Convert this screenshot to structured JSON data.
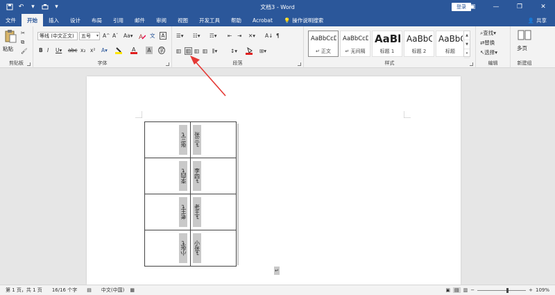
{
  "window": {
    "title": "文档3 - Word",
    "login_label": "登录",
    "share_label": "共享"
  },
  "tabs": [
    {
      "label": "文件"
    },
    {
      "label": "开始"
    },
    {
      "label": "插入"
    },
    {
      "label": "设计"
    },
    {
      "label": "布局"
    },
    {
      "label": "引用"
    },
    {
      "label": "邮件"
    },
    {
      "label": "审阅"
    },
    {
      "label": "视图"
    },
    {
      "label": "开发工具"
    },
    {
      "label": "帮助"
    },
    {
      "label": "Acrobat"
    },
    {
      "label": "操作说明搜索"
    }
  ],
  "ribbon": {
    "clipboard": {
      "label": "剪贴板",
      "paste": "粘贴"
    },
    "font": {
      "label": "字体",
      "font_name": "等线 (中文正文)",
      "font_size": "五号"
    },
    "paragraph": {
      "label": "段落"
    },
    "styles": {
      "label": "样式",
      "items": [
        {
          "sample": "AaBbCcDc",
          "name": "↵ 正文"
        },
        {
          "sample": "AaBbCcDc",
          "name": "↵ 无间隔"
        },
        {
          "sample": "AaBl",
          "name": "标题 1"
        },
        {
          "sample": "AaBbC",
          "name": "标题 2"
        },
        {
          "sample": "AaBbC",
          "name": "标题"
        }
      ]
    },
    "editing": {
      "label": "编辑",
      "find": "查找",
      "replace": "替换",
      "select": "选择"
    },
    "newgroup": {
      "label": "新建组",
      "multipage": "多页"
    }
  },
  "document": {
    "rows": [
      {
        "a": "张三↵",
        "b": "张三↵"
      },
      {
        "a": "李四↵",
        "b": "李四↵"
      },
      {
        "a": "老王↵",
        "b": "老王↵"
      },
      {
        "a": "小张↵",
        "b": "小张↵"
      }
    ]
  },
  "status": {
    "page": "第 1 页，共 1 页",
    "words": "16/16 个字",
    "language": "中文(中国)",
    "zoom": "109%",
    "zoom_slider_fraction": 0.6
  },
  "colors": {
    "brand": "#2b579a",
    "annotation": "#e53935"
  }
}
